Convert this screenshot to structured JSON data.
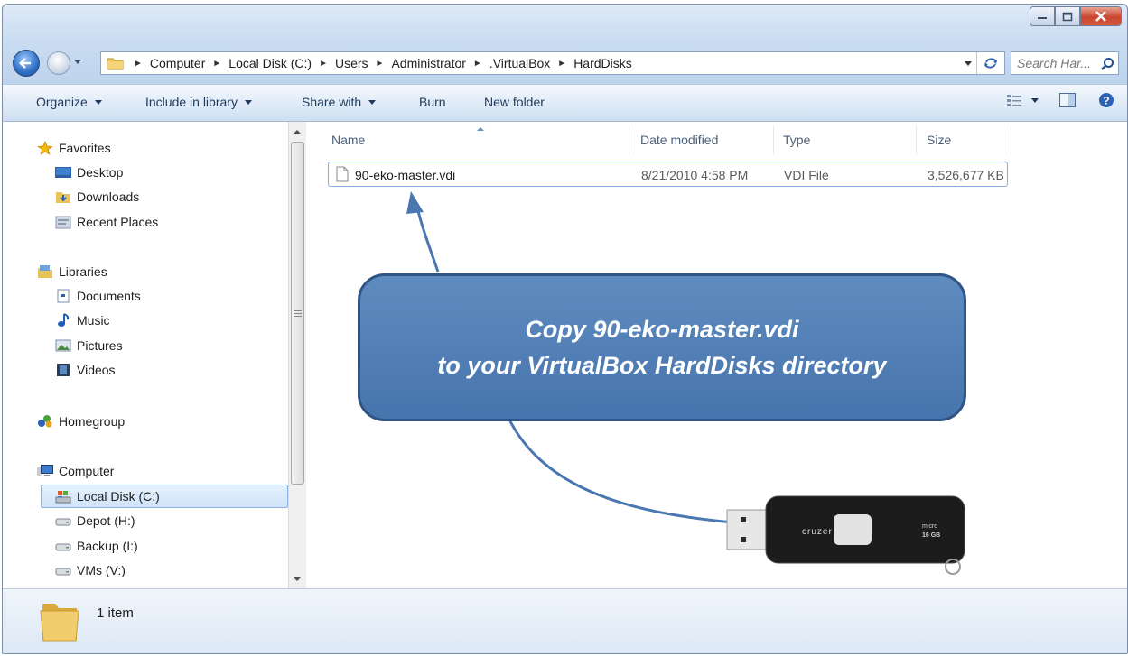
{
  "window": {
    "caption_buttons": [
      "minimize-icon",
      "maximize-icon",
      "close-icon"
    ]
  },
  "address": {
    "breadcrumbs": [
      "Computer",
      "Local Disk (C:)",
      "Users",
      "Administrator",
      ".VirtualBox",
      "HardDisks"
    ],
    "search_placeholder": "Search Har..."
  },
  "toolbar": {
    "organize": "Organize",
    "include_in_library": "Include in library",
    "share_with": "Share with",
    "burn": "Burn",
    "new_folder": "New folder"
  },
  "sidebar": {
    "items": [
      {
        "label": "Favorites",
        "icon": "star-icon"
      },
      {
        "label": "Desktop",
        "icon": "desktop-icon"
      },
      {
        "label": "Downloads",
        "icon": "downloads-icon"
      },
      {
        "label": "Recent Places",
        "icon": "recent-places-icon"
      },
      {
        "label": "Libraries",
        "icon": "libraries-icon"
      },
      {
        "label": "Documents",
        "icon": "documents-icon"
      },
      {
        "label": "Music",
        "icon": "music-icon"
      },
      {
        "label": "Pictures",
        "icon": "pictures-icon"
      },
      {
        "label": "Videos",
        "icon": "videos-icon"
      },
      {
        "label": "Homegroup",
        "icon": "homegroup-icon"
      },
      {
        "label": "Computer",
        "icon": "computer-icon"
      },
      {
        "label": "Local Disk (C:)",
        "icon": "local-disk-icon",
        "selected": true
      },
      {
        "label": "Depot (H:)",
        "icon": "drive-icon"
      },
      {
        "label": "Backup (I:)",
        "icon": "drive-icon"
      },
      {
        "label": "VMs (V:)",
        "icon": "drive-icon"
      }
    ]
  },
  "file_list": {
    "columns": [
      "Name",
      "Date modified",
      "Type",
      "Size"
    ],
    "rows": [
      {
        "name": "90-eko-master.vdi",
        "date_modified": "8/21/2010 4:58 PM",
        "type": "VDI File",
        "size": "3,526,677 KB"
      }
    ]
  },
  "callout": {
    "line1": "Copy 90-eko-master.vdi",
    "line2": "to your VirtualBox HardDisks directory"
  },
  "usb_drive": {
    "brand": "cruzer",
    "model": "micro",
    "capacity": "16 GB"
  },
  "status": {
    "item_count": "1 item"
  },
  "colors": {
    "callout_fill": "#4F7DB6",
    "callout_border": "#2F5486",
    "callout_text": "#FFFFFF",
    "selection_border": "#84ACDD"
  }
}
